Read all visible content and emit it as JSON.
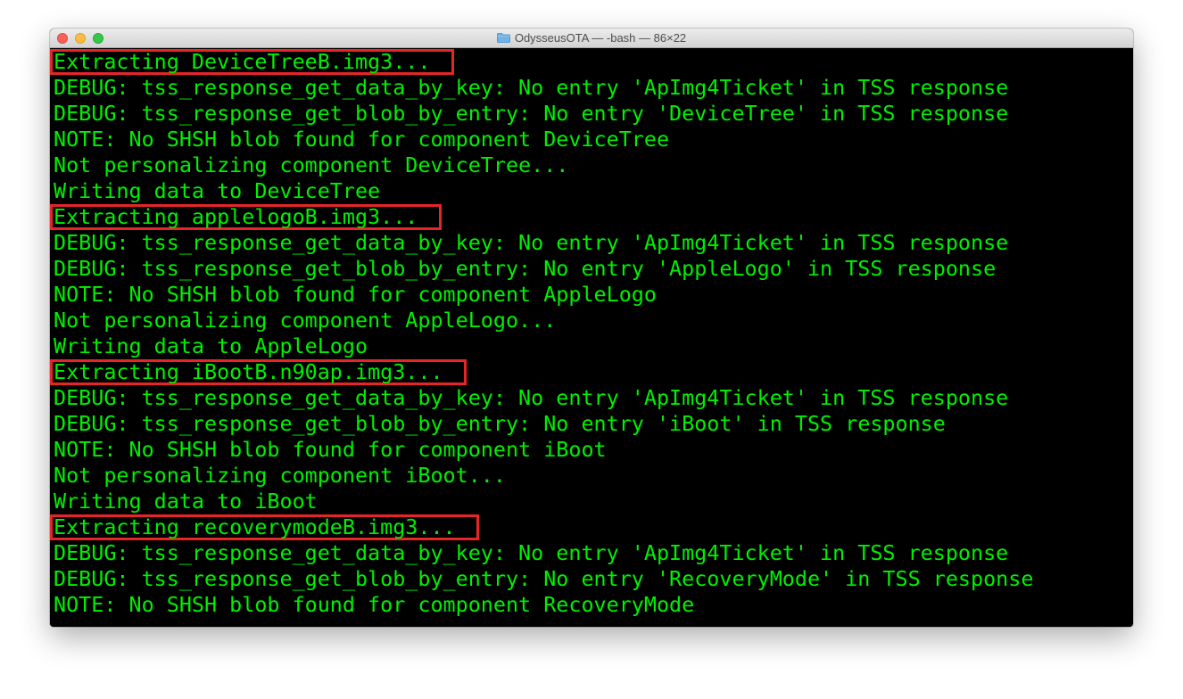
{
  "window": {
    "title": "OdysseusOTA — -bash — 86×22",
    "title_icon": "folder-icon",
    "traffic_lights": [
      "close",
      "minimize",
      "zoom"
    ]
  },
  "terminal": {
    "text_color": "#00f000",
    "background": "#000000",
    "highlight_color": "#e52526",
    "lines": [
      "Extracting DeviceTreeB.img3...",
      "DEBUG: tss_response_get_data_by_key: No entry 'ApImg4Ticket' in TSS response",
      "DEBUG: tss_response_get_blob_by_entry: No entry 'DeviceTree' in TSS response",
      "NOTE: No SHSH blob found for component DeviceTree",
      "Not personalizing component DeviceTree...",
      "Writing data to DeviceTree",
      "Extracting applelogoB.img3...",
      "DEBUG: tss_response_get_data_by_key: No entry 'ApImg4Ticket' in TSS response",
      "DEBUG: tss_response_get_blob_by_entry: No entry 'AppleLogo' in TSS response",
      "NOTE: No SHSH blob found for component AppleLogo",
      "Not personalizing component AppleLogo...",
      "Writing data to AppleLogo",
      "Extracting iBootB.n90ap.img3...",
      "DEBUG: tss_response_get_data_by_key: No entry 'ApImg4Ticket' in TSS response",
      "DEBUG: tss_response_get_blob_by_entry: No entry 'iBoot' in TSS response",
      "NOTE: No SHSH blob found for component iBoot",
      "Not personalizing component iBoot...",
      "Writing data to iBoot",
      "Extracting recoverymodeB.img3...",
      "DEBUG: tss_response_get_data_by_key: No entry 'ApImg4Ticket' in TSS response",
      "DEBUG: tss_response_get_blob_by_entry: No entry 'RecoveryMode' in TSS response",
      "NOTE: No SHSH blob found for component RecoveryMode"
    ],
    "highlighted_lines": [
      0,
      6,
      12,
      18
    ]
  }
}
